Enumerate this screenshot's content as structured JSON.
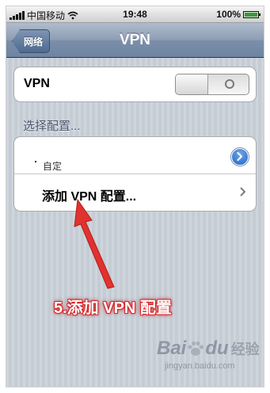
{
  "status_bar": {
    "carrier": "中国移动",
    "time": "19:48",
    "battery": "100%",
    "battery_level": 1.0
  },
  "nav": {
    "back_label": "网络",
    "title": "VPN"
  },
  "vpn_toggle": {
    "label": "VPN",
    "state": "off"
  },
  "section": {
    "header": "选择配置..."
  },
  "configs": [
    {
      "label": "自定",
      "accessory": "detail-disclosure"
    },
    {
      "label": "添加 VPN 配置...",
      "accessory": "chevron"
    }
  ],
  "annotation": {
    "text": "5.添加 VPN 配置",
    "color": "#d8262a"
  },
  "watermark": {
    "brand_prefix": "Bai",
    "brand_suffix": "du",
    "brand_cn": "经验",
    "url": "jingyan.baidu.com"
  },
  "colors": {
    "nav_bar": "#6d84a2",
    "background": "#c5ccd4",
    "disclosure": "#2367c6",
    "arrow": "#e0322f"
  }
}
